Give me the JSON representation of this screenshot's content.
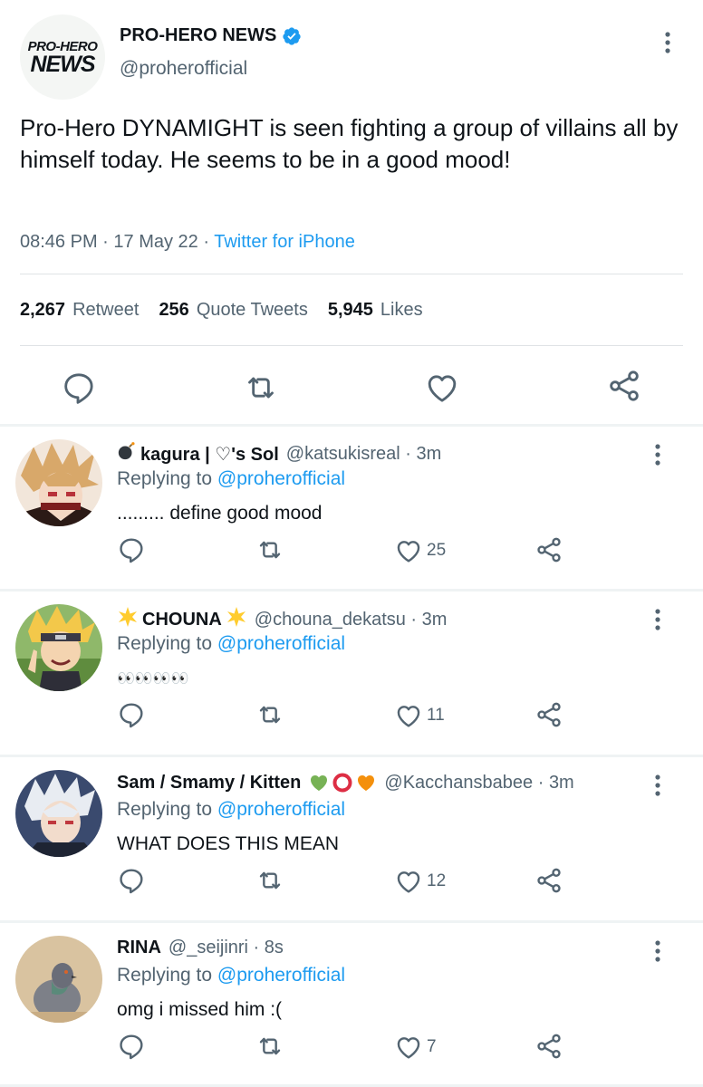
{
  "main": {
    "avatar_line1": "PRO-HERO",
    "avatar_line2": "NEWS",
    "name": "PRO-HERO NEWS",
    "handle": "@proherofficial",
    "text": "Pro-Hero DYNAMIGHT is seen fighting a group of villains all by himself today. He seems to be in a good mood!",
    "time": "08:46 PM",
    "date": "17 May 22",
    "source": "Twitter for iPhone",
    "retweets": "2,267",
    "retweets_label": "Retweet",
    "quotes": "256",
    "quotes_label": "Quote Tweets",
    "likes": "5,945",
    "likes_label": "Likes"
  },
  "replies": [
    {
      "name": "kagura | ♡'s Sol",
      "name_emoji": "bomb-emoji",
      "handle": "@katsukisreal",
      "time": "3m",
      "replying_label": "Replying to",
      "replying_to": "@proherofficial",
      "text": "......... define good mood",
      "likes": "25"
    },
    {
      "name": "CHOUNA",
      "name_emoji": "star-emoji",
      "handle": "@chouna_dekatsu",
      "time": "3m",
      "replying_label": "Replying to",
      "replying_to": "@proherofficial",
      "text": "👀👀👀👀",
      "likes": "11"
    },
    {
      "name": "Sam / Smamy / Kitten",
      "name_emoji": "hearts-emoji",
      "handle": "@Kacchansbabee",
      "time": "3m",
      "replying_label": "Replying to",
      "replying_to": "@proherofficial",
      "text": "WHAT DOES THIS MEAN",
      "likes": "12"
    },
    {
      "name": "RINA",
      "handle": "@_seijinri",
      "time": "8s",
      "replying_label": "Replying to",
      "replying_to": "@proherofficial",
      "text": "omg i missed him :(",
      "likes": "7"
    }
  ],
  "colors": {
    "accent": "#1d9bf0",
    "secondary_text": "#536471",
    "icon": "#536471",
    "divider": "#eff3f4"
  }
}
